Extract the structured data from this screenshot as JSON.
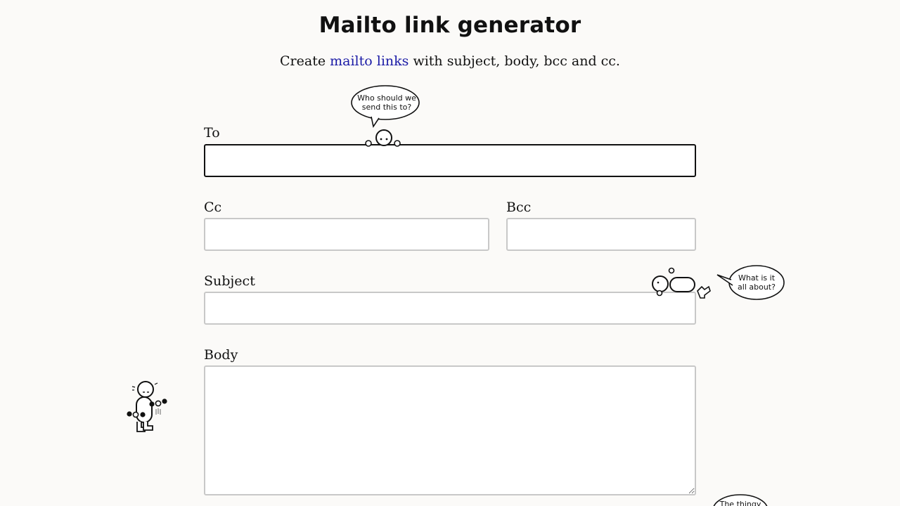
{
  "page": {
    "title": "Mailto link generator",
    "subtitle_before": "Create ",
    "subtitle_link": "mailto links",
    "subtitle_after": " with subject, body, bcc and cc."
  },
  "form": {
    "to_label": "To",
    "to_value": "",
    "cc_label": "Cc",
    "cc_value": "",
    "bcc_label": "Bcc",
    "bcc_value": "",
    "subject_label": "Subject",
    "subject_value": "",
    "body_label": "Body",
    "body_value": ""
  },
  "doodles": {
    "to_bubble_line1": "Who should we",
    "to_bubble_line2": "send this to?",
    "subject_bubble_line1": "What is it",
    "subject_bubble_line2": "all about?",
    "bottom_bubble": "The thingy"
  }
}
